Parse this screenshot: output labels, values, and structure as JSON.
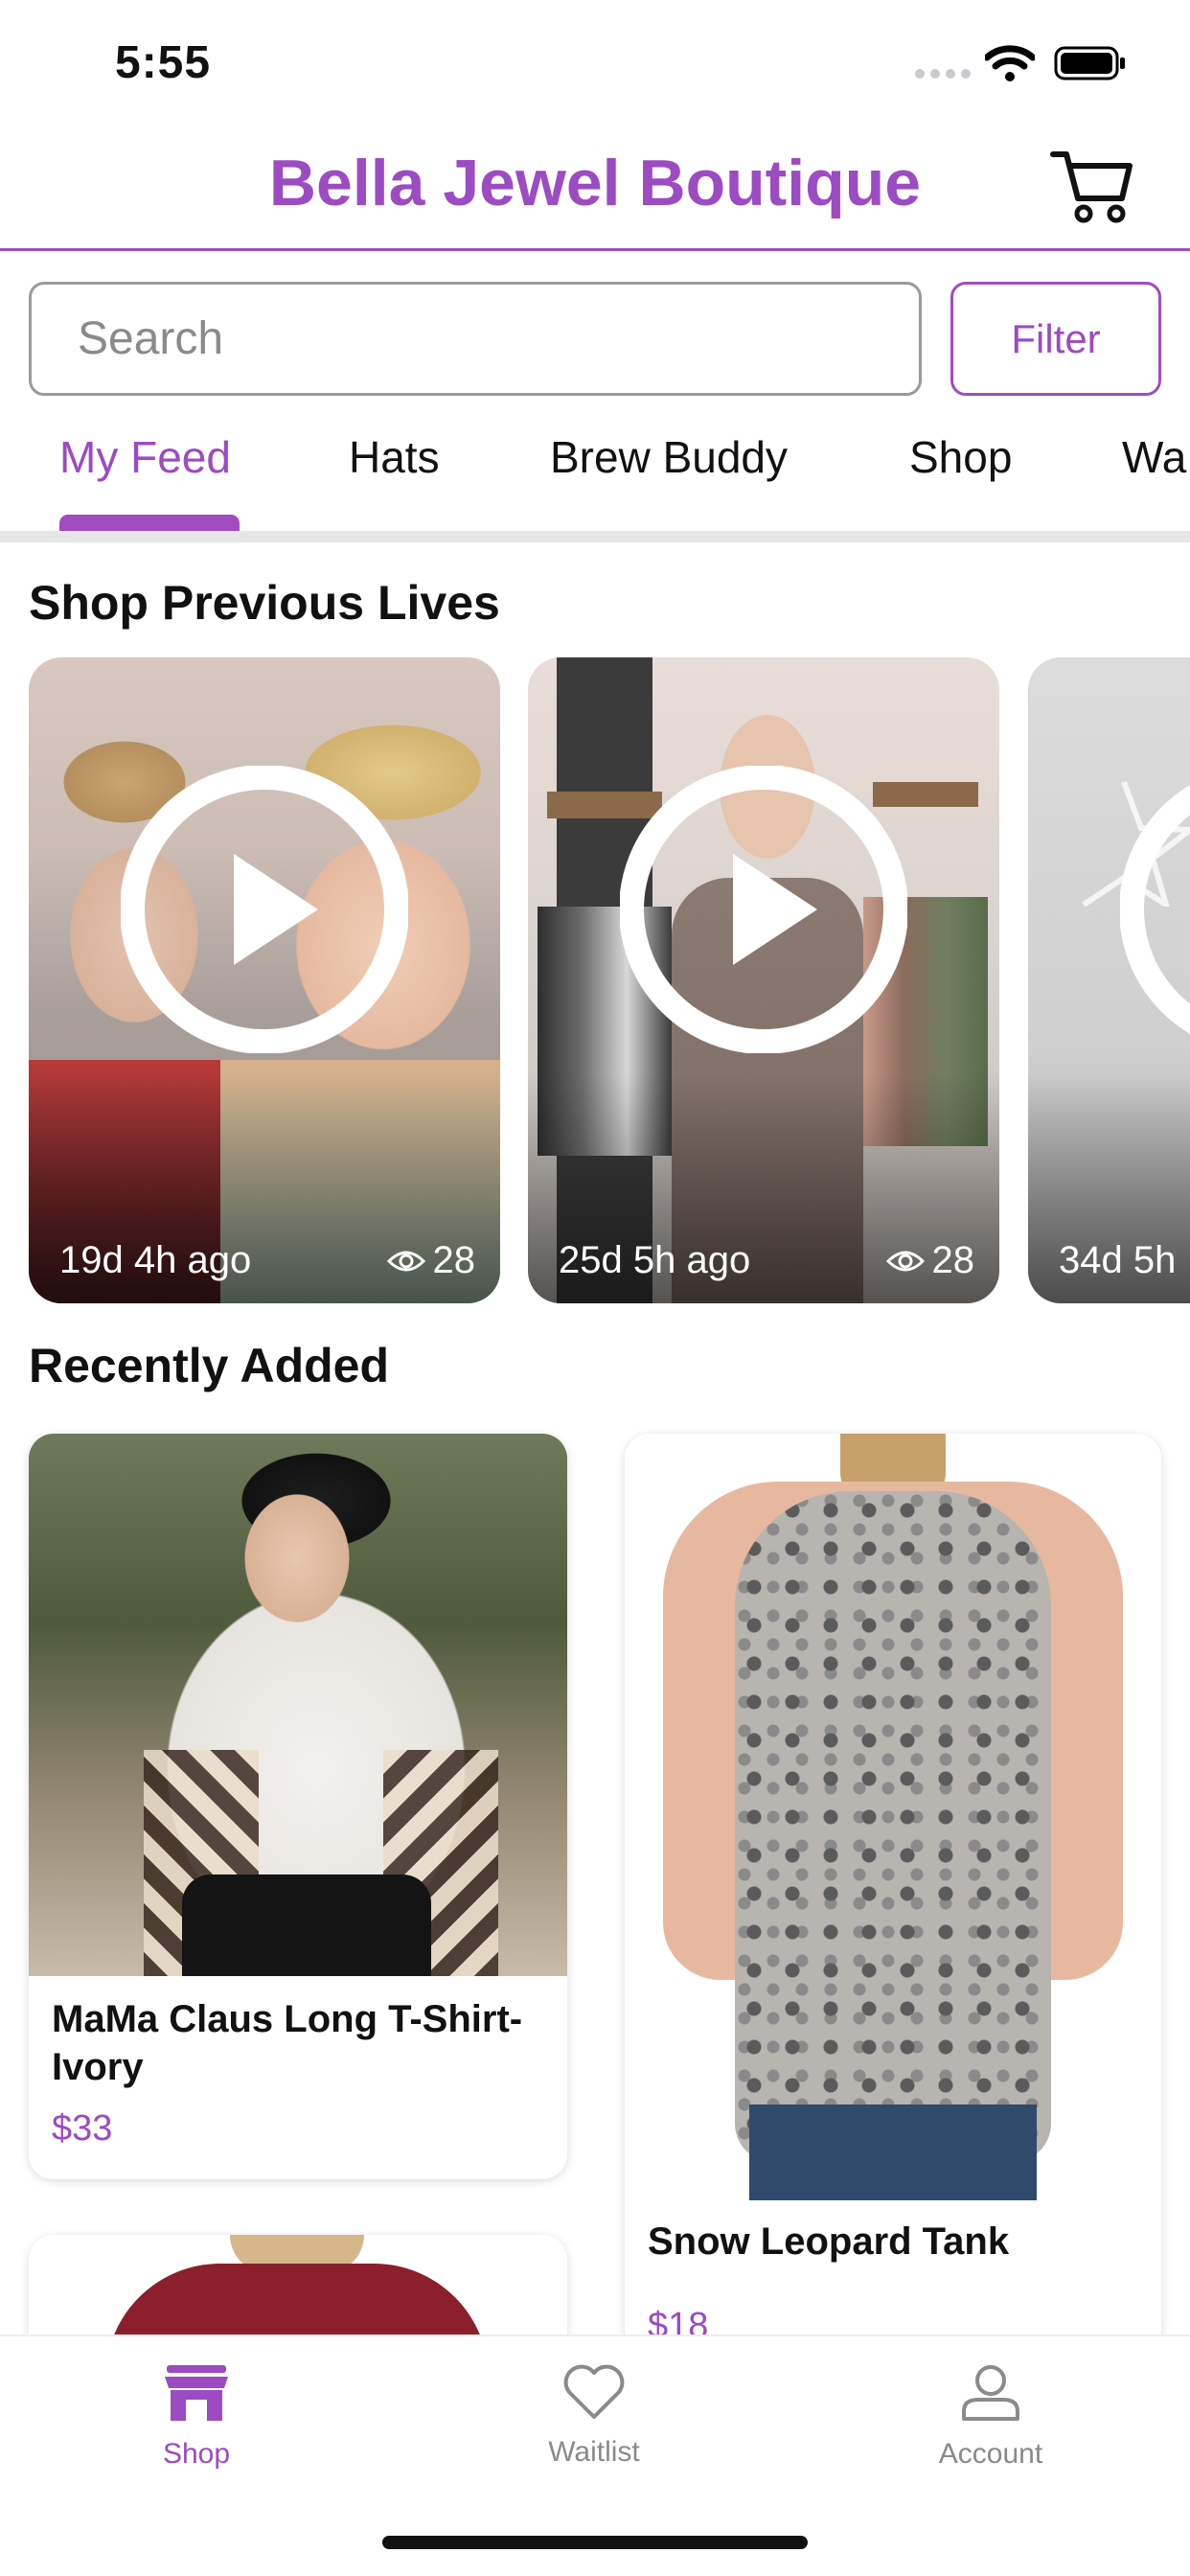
{
  "status_bar": {
    "time": "5:55"
  },
  "header": {
    "title": "Bella Jewel Boutique",
    "cart_icon": "cart-icon"
  },
  "search": {
    "placeholder": "Search",
    "filter_label": "Filter"
  },
  "tabs": [
    {
      "label": "My Feed",
      "active": true
    },
    {
      "label": "Hats"
    },
    {
      "label": "Brew Buddy"
    },
    {
      "label": "Shop"
    },
    {
      "label": "Wa"
    }
  ],
  "previous_lives": {
    "title": "Shop Previous Lives",
    "items": [
      {
        "ago": "19d 4h ago",
        "views": "28"
      },
      {
        "ago": "25d 5h ago",
        "views": "28"
      },
      {
        "ago": "34d 5h"
      }
    ]
  },
  "recently_added": {
    "title": "Recently Added",
    "products": [
      {
        "name": "MaMa Claus Long T-Shirt-Ivory",
        "price": "$33"
      },
      {
        "name": "Snow Leopard Tank",
        "price": "$18"
      },
      {
        "name": "",
        "price": ""
      }
    ]
  },
  "bottom_nav": [
    {
      "label": "Shop",
      "icon": "store-icon",
      "active": true
    },
    {
      "label": "Waitlist",
      "icon": "heart-icon"
    },
    {
      "label": "Account",
      "icon": "person-icon"
    }
  ],
  "colors": {
    "accent": "#9c4bc3",
    "text": "#111111",
    "muted": "#8a8a8a"
  }
}
